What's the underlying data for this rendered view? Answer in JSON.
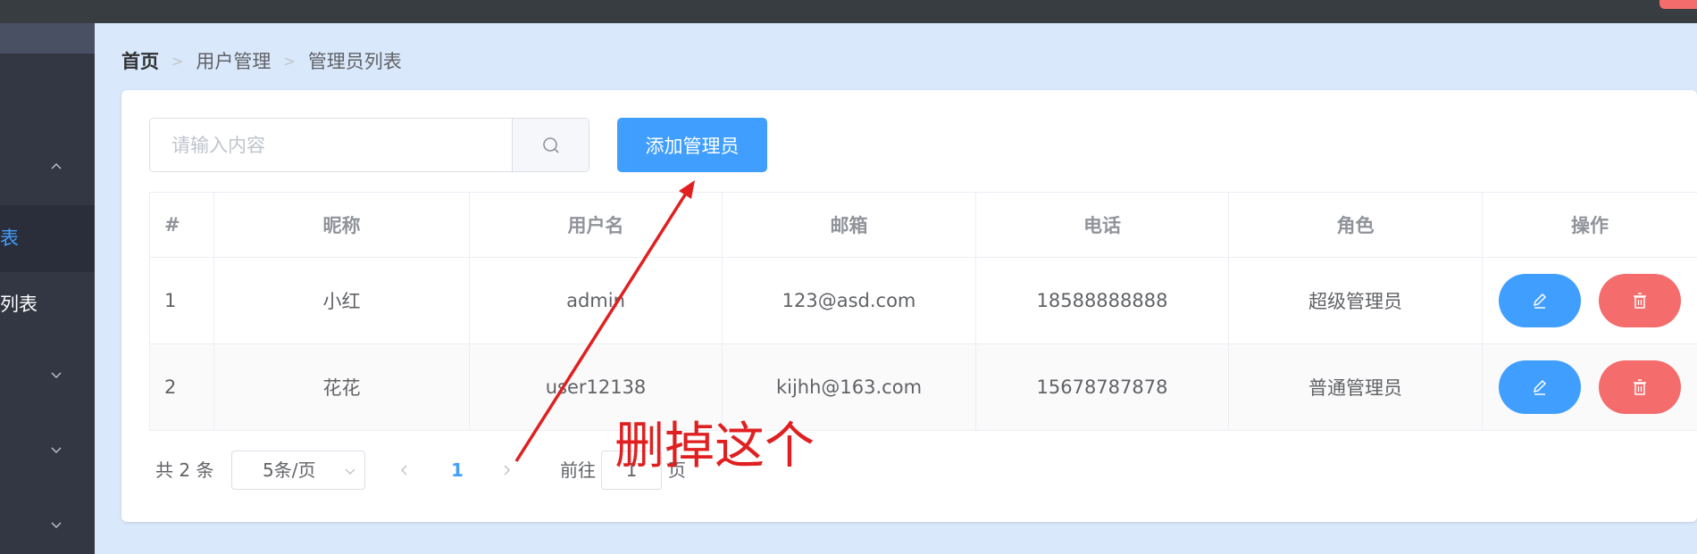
{
  "breadcrumb": {
    "home": "首页",
    "level1": "用户管理",
    "level2": "管理员列表"
  },
  "sidebar": {
    "items": [
      {
        "label": "",
        "icon": "chevron-up-icon",
        "active": false
      },
      {
        "label": "表",
        "active": true
      },
      {
        "label": "列表",
        "active": false
      },
      {
        "label": "",
        "icon": "chevron-down-icon"
      },
      {
        "label": "",
        "icon": "chevron-down-icon"
      },
      {
        "label": "",
        "icon": "chevron-down-icon"
      }
    ]
  },
  "search": {
    "placeholder": "请输入内容",
    "icon": "search-icon"
  },
  "toolbar": {
    "add_label": "添加管理员"
  },
  "table": {
    "headers": [
      "#",
      "昵称",
      "用户名",
      "邮箱",
      "电话",
      "角色",
      "操作"
    ],
    "rows": [
      {
        "index": "1",
        "nickname": "小红",
        "username": "admin",
        "email": "123@asd.com",
        "phone": "18588888888",
        "role": "超级管理员"
      },
      {
        "index": "2",
        "nickname": "花花",
        "username": "user12138",
        "email": "kijhh@163.com",
        "phone": "15678787878",
        "role": "普通管理员"
      }
    ],
    "actions": {
      "edit_icon": "edit-icon",
      "delete_icon": "trash-icon"
    }
  },
  "pagination": {
    "total": "共 2 条",
    "page_size": "5条/页",
    "current_page": "1",
    "goto_label": "前往",
    "goto_value": "1",
    "page_unit": "页"
  },
  "annotation": {
    "text": "删掉这个"
  },
  "colors": {
    "primary": "#409eff",
    "danger": "#f56c6c",
    "sidebar": "#333744",
    "annotation": "#e02020",
    "background": "#d9e8fb"
  }
}
